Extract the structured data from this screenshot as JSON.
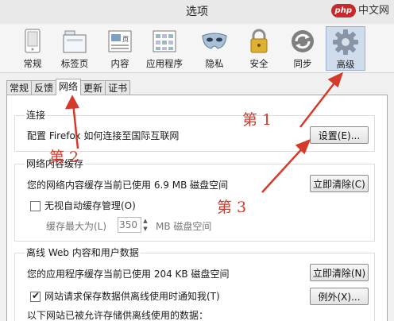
{
  "window": {
    "title": "选项"
  },
  "watermark": {
    "logo": "php",
    "text": "中文网"
  },
  "toolbar": {
    "items": [
      {
        "label": "常规",
        "icon": "general-icon"
      },
      {
        "label": "标签页",
        "icon": "tabs-icon"
      },
      {
        "label": "内容",
        "icon": "content-icon"
      },
      {
        "label": "应用程序",
        "icon": "applications-icon"
      },
      {
        "label": "隐私",
        "icon": "privacy-mask-icon"
      },
      {
        "label": "安全",
        "icon": "security-lock-icon"
      },
      {
        "label": "同步",
        "icon": "sync-icon"
      },
      {
        "label": "高级",
        "icon": "advanced-gear-icon",
        "selected": true
      }
    ]
  },
  "subtabs": [
    "常规",
    "反馈",
    "网络",
    "更新",
    "证书"
  ],
  "connection": {
    "title": "连接",
    "description": "配置 Firefox 如何连接至国际互联网",
    "settings_button": "设置(E)..."
  },
  "cache": {
    "title": "网络内容缓存",
    "usage": "您的网络内容缓存当前已使用 6.9 MB 磁盘空间",
    "clear_button": "立即清除(C)",
    "override_label": "无视自动缓存管理(O)",
    "override_checked": false,
    "limit_label": "缓存最大为(L)",
    "limit_value": "350",
    "limit_unit": "MB 磁盘空间"
  },
  "offline": {
    "title": "离线 Web 内容和用户数据",
    "usage": "您的应用程序缓存当前已使用 204 KB 磁盘空间",
    "clear_button": "立即清除(N)",
    "notify_label": "网站请求保存数据供离线使用时通知我(T)",
    "notify_checked": true,
    "exceptions_button": "例外(X)...",
    "list_label": "以下网站已被允许存储供离线使用的数据："
  },
  "annotations": {
    "first": "第 1",
    "second": "第 2",
    "third": "第 3",
    "color": "#d6392b"
  }
}
